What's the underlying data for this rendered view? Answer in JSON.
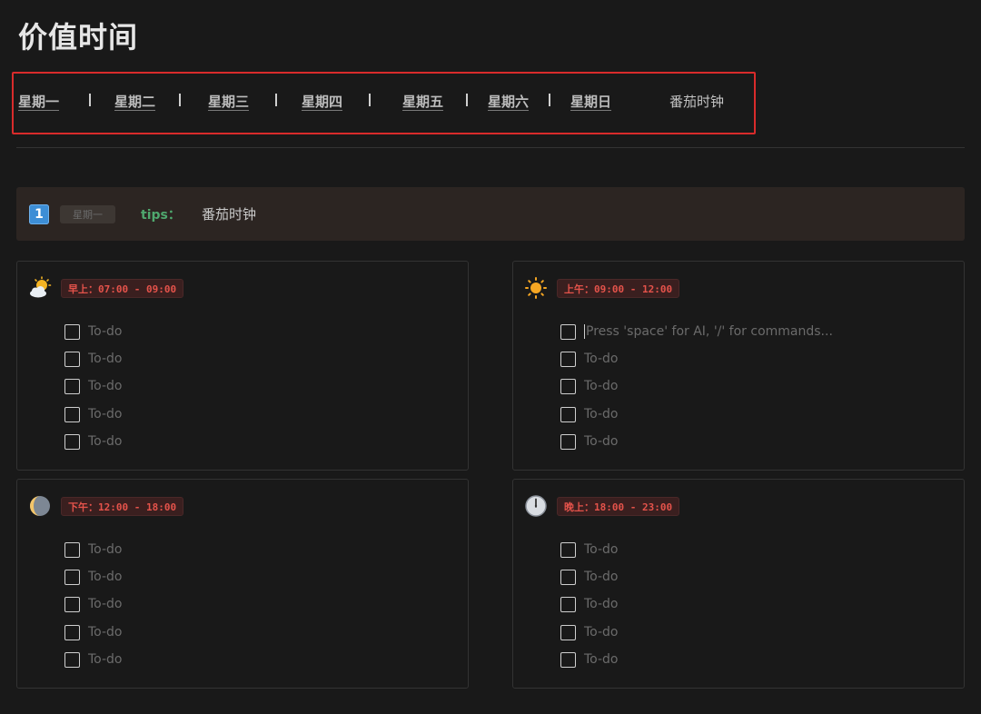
{
  "page": {
    "title": "价值时间"
  },
  "nav": {
    "items": [
      "星期一",
      "星期二",
      "星期三",
      "星期四",
      "星期五",
      "星期六",
      "星期日"
    ],
    "separator": "|",
    "pomodoro": "番茄时钟"
  },
  "callout": {
    "badge": "1",
    "day_tag": "星期一",
    "tips_label": "tips：",
    "link": "番茄时钟",
    "colors": {
      "background": "#2c2522",
      "tips": "#4fa86e",
      "badge": "#3d8ed6"
    }
  },
  "blocks": [
    {
      "icon": "sun-behind-cloud-icon",
      "time_label": "早上：07:00 - 09:00",
      "todos": [
        "To-do",
        "To-do",
        "To-do",
        "To-do",
        "To-do"
      ]
    },
    {
      "icon": "sun-icon",
      "time_label": "上午：09:00 - 12:00",
      "active_placeholder": "Press 'space' for AI, '/' for commands...",
      "todos": [
        "To-do",
        "To-do",
        "To-do",
        "To-do"
      ]
    },
    {
      "icon": "moon-icon",
      "time_label": "下午：12:00 - 18:00",
      "todos": [
        "To-do",
        "To-do",
        "To-do",
        "To-do",
        "To-do"
      ]
    },
    {
      "icon": "clock-icon",
      "time_label": "晚上：18:00 - 23:00",
      "todos": [
        "To-do",
        "To-do",
        "To-do",
        "To-do",
        "To-do"
      ]
    }
  ],
  "colors": {
    "page_bg": "#191919",
    "time_tag_text": "#e5534b",
    "nav_highlight_border": "#d92b2b"
  }
}
